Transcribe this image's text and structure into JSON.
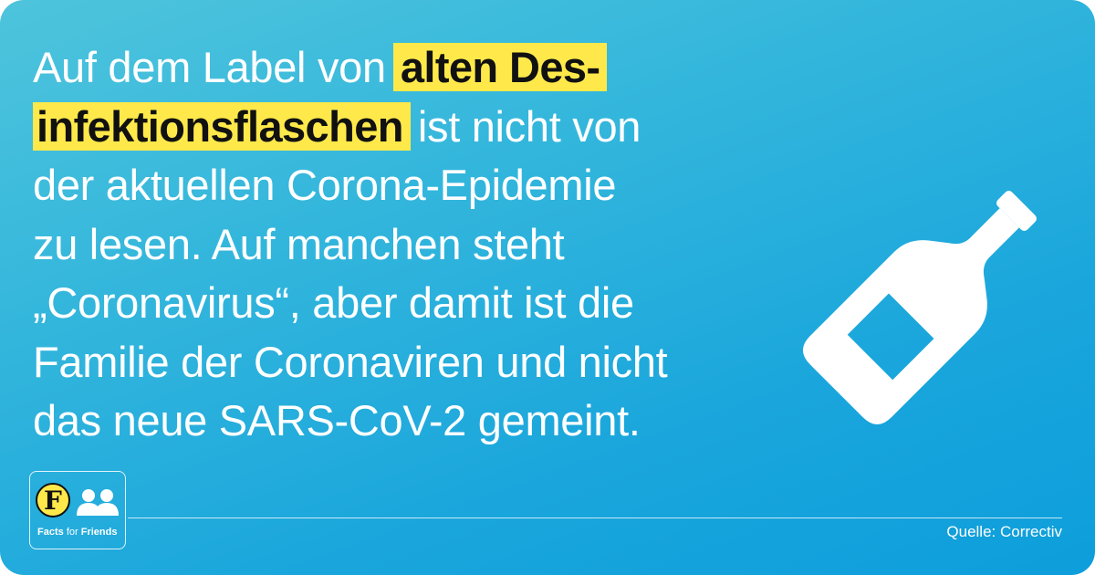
{
  "main_text": {
    "line1_prefix": "Auf dem Label von",
    "line1_highlight": "alten Des-",
    "line2_highlight": "infektionsflaschen",
    "line2_suffix": "ist nicht von",
    "line3": "der aktuellen Corona-Epidemie",
    "line4": "zu lesen. Auf manchen steht",
    "line5": "„Coronavirus“, aber damit ist die",
    "line6": "Familie der Coronaviren und nicht",
    "line7": "das neue SARS-CoV-2 gemeint."
  },
  "source": "Quelle: Correctiv",
  "logo": {
    "letter": "F",
    "text_prefix": "Facts",
    "text_middle": "for",
    "text_suffix": "Friends"
  },
  "icons": {
    "illustration": "bottle-icon",
    "logo_people": "people-icon"
  },
  "colors": {
    "highlight": "#ffe94a",
    "background_start": "#4ec4dc",
    "background_end": "#0d9edb",
    "text": "#ffffff"
  }
}
